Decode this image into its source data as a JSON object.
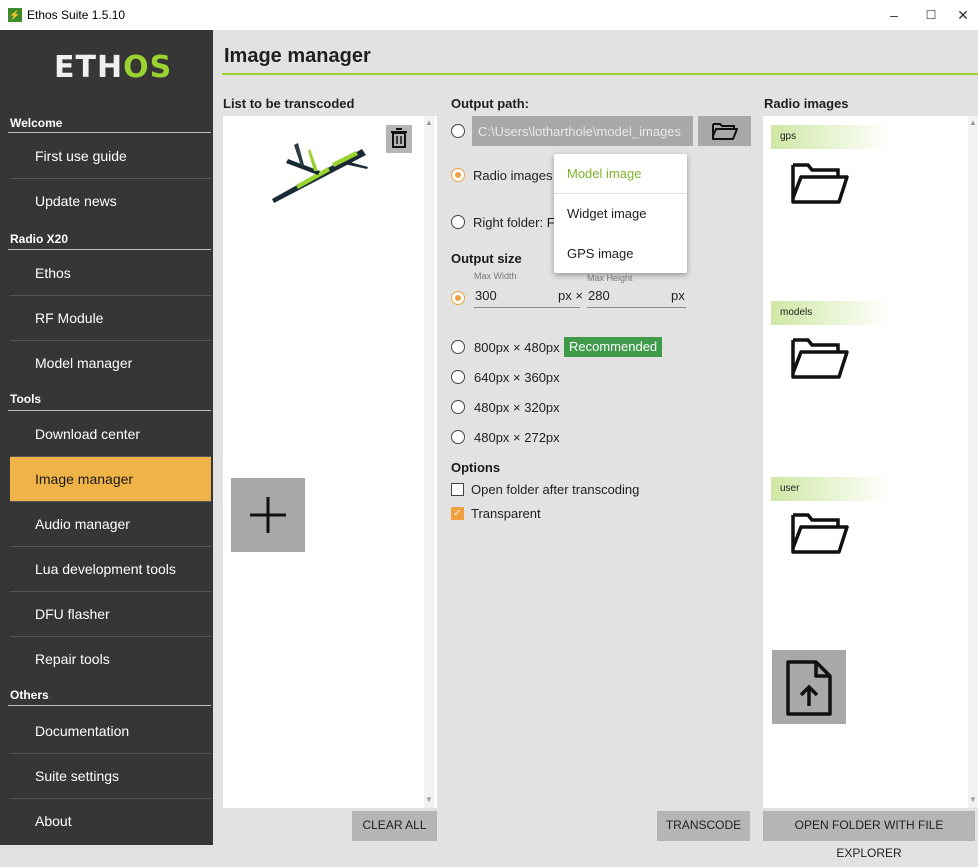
{
  "window": {
    "title": "Ethos Suite 1.5.10",
    "app_icon": "ethos-app-icon",
    "minimize": "–",
    "maximize": "☐",
    "close": "✕"
  },
  "sidebar": {
    "logo": {
      "part1": "ETH",
      "part2": "OS"
    },
    "sections": {
      "welcome": "Welcome",
      "radio": "Radio X20",
      "tools": "Tools",
      "others": "Others"
    },
    "items": {
      "first_use": "First use guide",
      "update_news": "Update news",
      "ethos": "Ethos",
      "rf_module": "RF Module",
      "model_manager": "Model manager",
      "download_center": "Download center",
      "image_manager": "Image manager",
      "audio_manager": "Audio manager",
      "lua_tools": "Lua development tools",
      "dfu_flasher": "DFU flasher",
      "repair_tools": "Repair tools",
      "documentation": "Documentation",
      "suite_settings": "Suite settings",
      "about": "About"
    },
    "active": "Image manager"
  },
  "header": {
    "title": "Image manager"
  },
  "list": {
    "heading": "List to be transcoded",
    "clear_all": "CLEAR ALL",
    "add_symbol": "+"
  },
  "output": {
    "heading": "Output path:",
    "path_value": "C:\\Users\\lotharthole\\model_images",
    "radio_images_label": "Radio images",
    "right_folder_label": "Right folder: F",
    "dropdown": [
      "Model image",
      "Widget image",
      "GPS image"
    ],
    "dropdown_selected": "Model image",
    "size_heading": "Output size",
    "max_width_label": "Max Width",
    "max_height_label": "Max Height",
    "width_value": "300",
    "width_unit": "px ×",
    "height_value": "280",
    "height_unit": "px",
    "sizes": [
      "800px × 480px",
      "640px × 360px",
      "480px × 320px",
      "480px × 272px"
    ],
    "recommended": "Recommended",
    "options_heading": "Options",
    "open_folder_option": "Open folder after transcoding",
    "transparent_option": "Transparent",
    "transcode": "TRANSCODE"
  },
  "radio_images": {
    "heading": "Radio images",
    "folders": [
      "gps",
      "models",
      "user"
    ],
    "open_explorer": "OPEN FOLDER WITH FILE EXPLORER"
  },
  "colors": {
    "accent_green": "#9ad330",
    "accent_orange": "#f0a040",
    "sidebar": "#363636",
    "active_item": "#f0b347",
    "recommended_bg": "#3f9a4a"
  }
}
